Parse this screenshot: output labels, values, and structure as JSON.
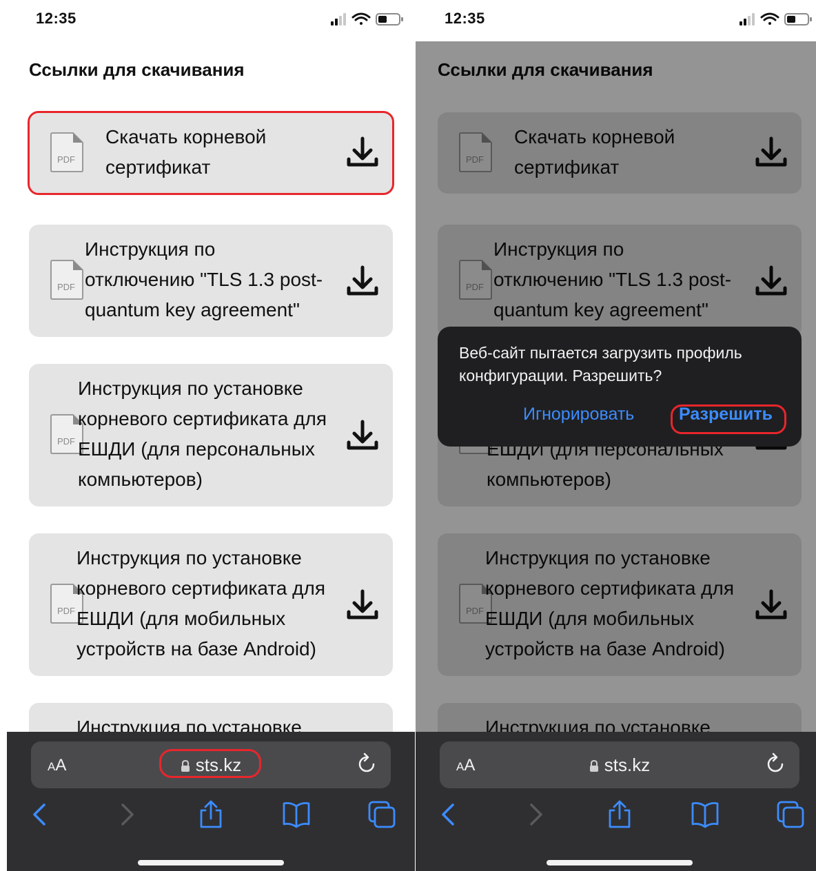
{
  "status_bar": {
    "time": "12:35"
  },
  "page": {
    "title": "Ссылки для скачивания"
  },
  "pdf_icon_label": "PDF",
  "cards": [
    {
      "lines": [
        "Скачать корневой",
        "сертификат"
      ]
    },
    {
      "lines": [
        "Инструкция по",
        "отключению \"TLS 1.3 post-",
        "quantum key agreement\""
      ]
    },
    {
      "lines": [
        "Инструкция по установке",
        "корневого сертификата для",
        "ЕШДИ (для персональных",
        "компьютеров)"
      ]
    },
    {
      "lines": [
        "Инструкция по установке",
        "корневого сертификата для",
        "ЕШДИ (для мобильных",
        "устройств на базе Android)"
      ]
    },
    {
      "lines": [
        "Инструкция по установке"
      ]
    }
  ],
  "browser": {
    "text_size_small": "A",
    "text_size_large": "A",
    "domain": "sts.kz"
  },
  "dialog": {
    "message": "Веб-сайт пытается загрузить профиль конфигурации. Разрешить?",
    "ignore_label": "Игнорировать",
    "allow_label": "Разрешить"
  },
  "icons": [
    "pdf-file-icon",
    "download-icon",
    "lock-icon",
    "reload-icon",
    "back-icon",
    "forward-icon",
    "share-icon",
    "bookmarks-icon",
    "tabs-icon",
    "signal-icon",
    "wifi-icon",
    "battery-icon"
  ],
  "colors": {
    "highlight": "#e8262b",
    "link_blue": "#3c8cff",
    "card_bg": "#e4e4e4",
    "toolbar_bg": "#2f2f31"
  }
}
